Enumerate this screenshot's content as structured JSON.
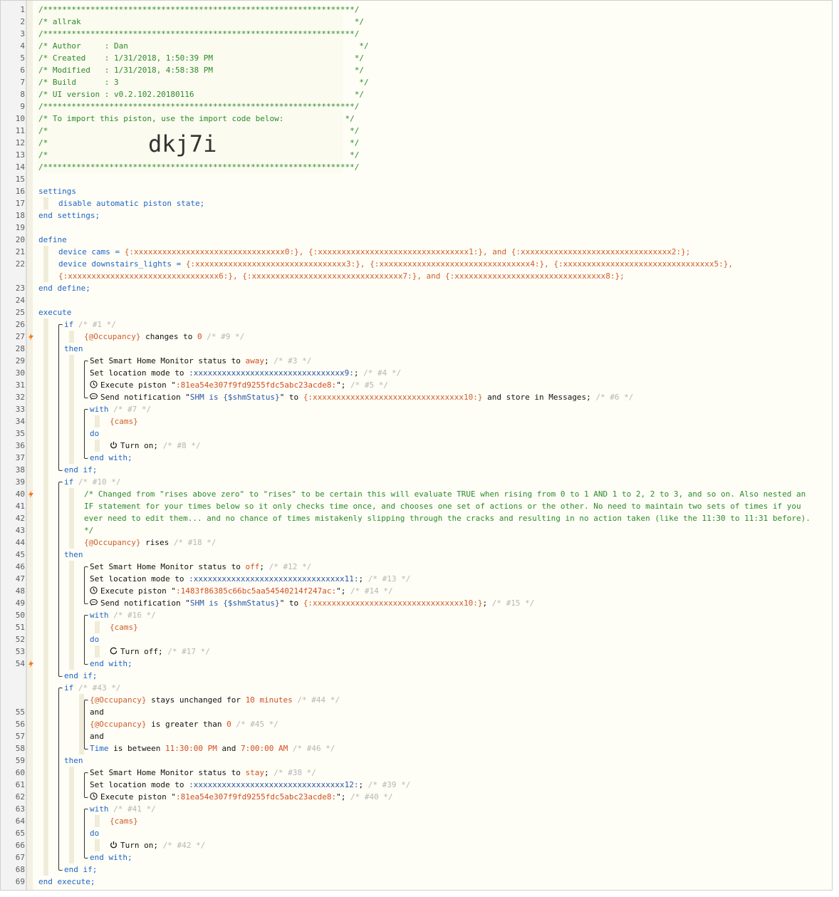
{
  "header_comment": {
    "title_line": "/* allrak                                                          */",
    "author": "/* Author     : Dan                                                 */",
    "created": "/* Created    : 1/31/2018, 1:50:39 PM                              */",
    "modified": "/* Modified   : 1/31/2018, 4:58:38 PM                              */",
    "build": "/* Build      : 3                                                   */",
    "ui_version": "/* UI version : v0.2.102.20180116                                  */",
    "import_note": "/* To import this piston, use the import code below:             */",
    "blank": "/*                                                                */",
    "stars": "/******************************************************************/",
    "import_code": "dkj7i"
  },
  "settings": {
    "open": "settings",
    "line": "disable automatic piston state;",
    "close": "end settings;"
  },
  "define": {
    "open": "define",
    "cams_decl": "device cams = ",
    "cams_value": "{:xxxxxxxxxxxxxxxxxxxxxxxxxxxxxxxx0:}, {:xxxxxxxxxxxxxxxxxxxxxxxxxxxxxxxx1:}, and {:xxxxxxxxxxxxxxxxxxxxxxxxxxxxxxxx2:};",
    "lights_decl": "device downstairs_lights = ",
    "lights_value_1": "{:xxxxxxxxxxxxxxxxxxxxxxxxxxxxxxxx3:}, {:xxxxxxxxxxxxxxxxxxxxxxxxxxxxxxxx4:}, {:xxxxxxxxxxxxxxxxxxxxxxxxxxxxxxxx5:},",
    "lights_value_2": "{:xxxxxxxxxxxxxxxxxxxxxxxxxxxxxxxx6:}, {:xxxxxxxxxxxxxxxxxxxxxxxxxxxxxxxx7:}, and {:xxxxxxxxxxxxxxxxxxxxxxxxxxxxxxxx8:};",
    "close": "end define;"
  },
  "execute": {
    "open": "execute",
    "close": "end execute;",
    "if1": {
      "cond_var": "{@Occupancy}",
      "cond_op": " changes to ",
      "cond_val": "0",
      "cond_cmt": " /* #9 */",
      "if_cmt": " /* #1 */",
      "a1": "Set Smart Home Monitor status to ",
      "a1v": "away",
      "a1c": "; ",
      "a1cm": "/* #3 */",
      "a2": "Set location mode to ",
      "a2v": ":xxxxxxxxxxxxxxxxxxxxxxxxxxxxxxxx9:",
      "a2c": "; ",
      "a2cm": "/* #4 */",
      "a3": "Execute piston \"",
      "a3v": ":81ea54e307f9fd9255fdc5abc23acde8:",
      "a3c": "\"; ",
      "a3cm": "/* #5 */",
      "a4": "Send notification \"",
      "a4v": "SHM is {$shmStatus}",
      "a4m": "\" to ",
      "a4t": "{:xxxxxxxxxxxxxxxxxxxxxxxxxxxxxxxx10:}",
      "a4e": " and store in Messages; ",
      "a4cm": "/* #6 */",
      "with_cmt": " /* #7 */",
      "dev": "{cams}",
      "act": "Turn on; ",
      "act_cmt": "/* #8 */"
    },
    "if2": {
      "if_cmt": " /* #10 */",
      "note1": "/* Changed from \"rises above zero\" to \"rises\" to be certain this will evaluate TRUE when rising from 0 to 1 AND 1 to 2, 2 to 3, and so on. Also nested an",
      "note2": "IF statement for your times below so it only checks time once, and chooses one set of actions or the other. No need to maintain two sets of times if you",
      "note3": "ever need to edit them... and no chance of times mistakenly slipping through the cracks and resulting in no action taken (like the 11:30 to 11:31 before).",
      "note4": "*/",
      "cond_var": "{@Occupancy}",
      "cond_op": " rises",
      "cond_cmt": " /* #18 */",
      "a1": "Set Smart Home Monitor status to ",
      "a1v": "off",
      "a1c": "; ",
      "a1cm": "/* #12 */",
      "a2": "Set location mode to ",
      "a2v": ":xxxxxxxxxxxxxxxxxxxxxxxxxxxxxxxx11:",
      "a2c": "; ",
      "a2cm": "/* #13 */",
      "a3": "Execute piston \"",
      "a3v": ":1483f86385c66bc5aa54540214f247ac:",
      "a3c": "\"; ",
      "a3cm": "/* #14 */",
      "a4": "Send notification \"",
      "a4v": "SHM is {$shmStatus}",
      "a4m": "\" to ",
      "a4t": "{:xxxxxxxxxxxxxxxxxxxxxxxxxxxxxxxx10:}",
      "a4e": "; ",
      "a4cm": "/* #15 */",
      "with_cmt": " /* #16 */",
      "dev": "{cams}",
      "act": "Turn off; ",
      "act_cmt": "/* #17 */"
    },
    "if3": {
      "if_cmt": " /* #43 */",
      "c1v": "{@Occupancy}",
      "c1o": " stays unchanged for ",
      "c1n": "10",
      "c1u": " minutes",
      "c1cm": " /* #44 */",
      "and": "and",
      "c2v": "{@Occupancy}",
      "c2o": " is greater than ",
      "c2n": "0",
      "c2cm": " /* #45 */",
      "c3v": "Time",
      "c3o": " is between ",
      "c3a": "11:30:00 PM",
      "c3m": " and ",
      "c3b": "7:00:00 AM",
      "c3cm": " /* #46 */",
      "a1": "Set Smart Home Monitor status to ",
      "a1v": "stay",
      "a1c": "; ",
      "a1cm": "/* #38 */",
      "a2": "Set location mode to ",
      "a2v": ":xxxxxxxxxxxxxxxxxxxxxxxxxxxxxxxx12:",
      "a2c": "; ",
      "a2cm": "/* #39 */",
      "a3": "Execute piston \"",
      "a3v": ":81ea54e307f9fd9255fdc5abc23acde8:",
      "a3c": "\"; ",
      "a3cm": "/* #40 */",
      "with_cmt": " /* #41 */",
      "dev": "{cams}",
      "act": "Turn on; ",
      "act_cmt": "/* #42 */"
    },
    "kw_if": "if",
    "kw_then": "then",
    "kw_end_if": "end if;",
    "kw_with": "with",
    "kw_do": "do",
    "kw_end_with": "end with;"
  },
  "line_numbers": [
    "1",
    "2",
    "3",
    "4",
    "5",
    "6",
    "7",
    "8",
    "9",
    "10",
    "11",
    "12",
    "13",
    "14",
    "15",
    "16",
    "17",
    "18",
    "19",
    "20",
    "21",
    "22",
    "23",
    "24",
    "25",
    "26",
    "27",
    "28",
    "29",
    "30",
    "31",
    "32",
    "33",
    "34",
    "35",
    "36",
    "37",
    "38",
    "39",
    "40",
    "41",
    "42",
    "43",
    "44",
    "45",
    "46",
    "47",
    "48",
    "49",
    "50",
    "51",
    "52",
    "53",
    "54",
    "55",
    "56",
    "57",
    "58",
    "59",
    "60",
    "61",
    "62",
    "63",
    "64",
    "65",
    "66",
    "67",
    "68",
    "69"
  ],
  "line_rows": [
    1,
    2,
    3,
    4,
    5,
    6,
    7,
    8,
    9,
    10,
    11,
    12,
    13,
    14,
    15,
    16,
    17,
    18,
    19,
    20,
    21,
    22,
    24,
    25,
    26,
    27,
    28,
    29,
    30,
    31,
    32,
    33,
    34,
    35,
    36,
    37,
    38,
    39,
    40,
    41,
    42,
    43,
    44,
    45,
    46,
    47,
    48,
    49,
    50,
    51,
    52,
    53,
    54,
    55,
    59,
    60,
    61,
    62,
    63,
    64,
    65,
    66,
    67,
    68,
    69,
    70,
    71,
    72,
    73
  ],
  "bolt_lines": [
    27,
    40,
    54
  ],
  "colors": {
    "comment": "#2c8a2c",
    "keyword": "#1f64c8",
    "variable": "#cf5c2a",
    "string": "#2a55a8",
    "dim": "#b5b5b5",
    "bolt": "#f07b1f"
  },
  "icons": {
    "execute": "clock-icon",
    "notify": "chat-bubble-icon",
    "turn_on": "power-icon",
    "turn_off": "power-off-icon",
    "trigger": "lightning-bolt-icon"
  }
}
